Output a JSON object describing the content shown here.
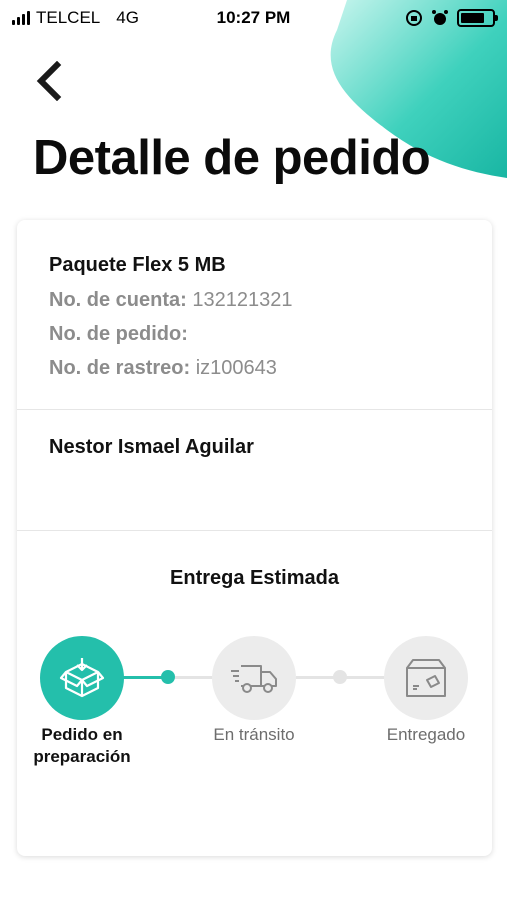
{
  "status_bar": {
    "carrier": "TELCEL",
    "network": "4G",
    "time": "10:27 PM"
  },
  "header": {
    "title": "Detalle de pedido"
  },
  "order": {
    "product": "Paquete Flex 5 MB",
    "account_label": "No. de cuenta:",
    "account_value": "132121321",
    "order_label": "No. de pedido:",
    "order_value": "",
    "tracking_label": "No. de rastreo:",
    "tracking_value": "iz100643"
  },
  "customer": {
    "name": "Nestor Ismael Aguilar"
  },
  "delivery": {
    "title": "Entrega Estimada",
    "steps": [
      {
        "label": "Pedido en preparación",
        "icon": "box-icon",
        "active": true
      },
      {
        "label": "En tránsito",
        "icon": "truck-icon",
        "active": false
      },
      {
        "label": "Entregado",
        "icon": "package-delivered-icon",
        "active": false
      }
    ]
  },
  "colors": {
    "accent": "#24bfab",
    "inactive": "#ececec",
    "muted_text": "#8c8c8c"
  }
}
